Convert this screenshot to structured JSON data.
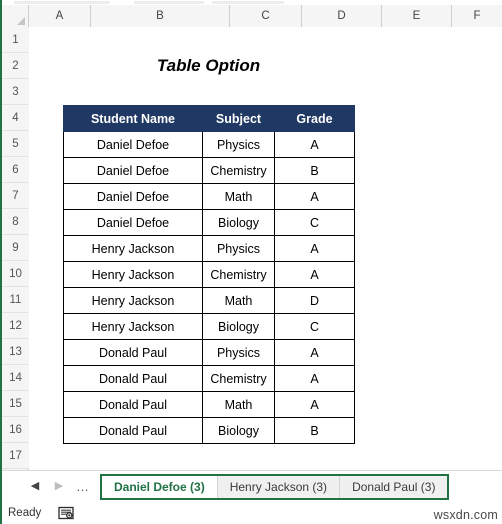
{
  "app": {
    "accent_green": "#217346",
    "header_navy": "#1f3864",
    "watermark": "wsxdn.com"
  },
  "columns": {
    "corner_icon": "select-all-triangle-icon",
    "labels": [
      "A",
      "B",
      "C",
      "D",
      "E",
      "F"
    ]
  },
  "rows": {
    "numbers": [
      "1",
      "2",
      "3",
      "4",
      "5",
      "6",
      "7",
      "8",
      "9",
      "10",
      "11",
      "12",
      "13",
      "14",
      "15",
      "16",
      "17"
    ]
  },
  "sheet": {
    "title": "Table Option"
  },
  "table": {
    "headers": [
      "Student Name",
      "Subject",
      "Grade"
    ],
    "rows": [
      [
        "Daniel Defoe",
        "Physics",
        "A"
      ],
      [
        "Daniel Defoe",
        "Chemistry",
        "B"
      ],
      [
        "Daniel Defoe",
        "Math",
        "A"
      ],
      [
        "Daniel Defoe",
        "Biology",
        "C"
      ],
      [
        "Henry Jackson",
        "Physics",
        "A"
      ],
      [
        "Henry Jackson",
        "Chemistry",
        "A"
      ],
      [
        "Henry Jackson",
        "Math",
        "D"
      ],
      [
        "Henry Jackson",
        "Biology",
        "C"
      ],
      [
        "Donald Paul",
        "Physics",
        "A"
      ],
      [
        "Donald Paul",
        "Chemistry",
        "A"
      ],
      [
        "Donald Paul",
        "Math",
        "A"
      ],
      [
        "Donald Paul",
        "Biology",
        "B"
      ]
    ]
  },
  "tab_bar": {
    "prev_icon": "triangle-left-icon",
    "next_icon": "triangle-right-icon",
    "overflow_icon": "ellipsis-icon",
    "tabs": [
      {
        "label": "Daniel Defoe (3)",
        "active": true
      },
      {
        "label": "Henry Jackson (3)",
        "active": false
      },
      {
        "label": "Donald Paul (3)",
        "active": false
      }
    ]
  },
  "status_bar": {
    "mode": "Ready",
    "accessibility_icon": "accessibility-checker-icon"
  }
}
